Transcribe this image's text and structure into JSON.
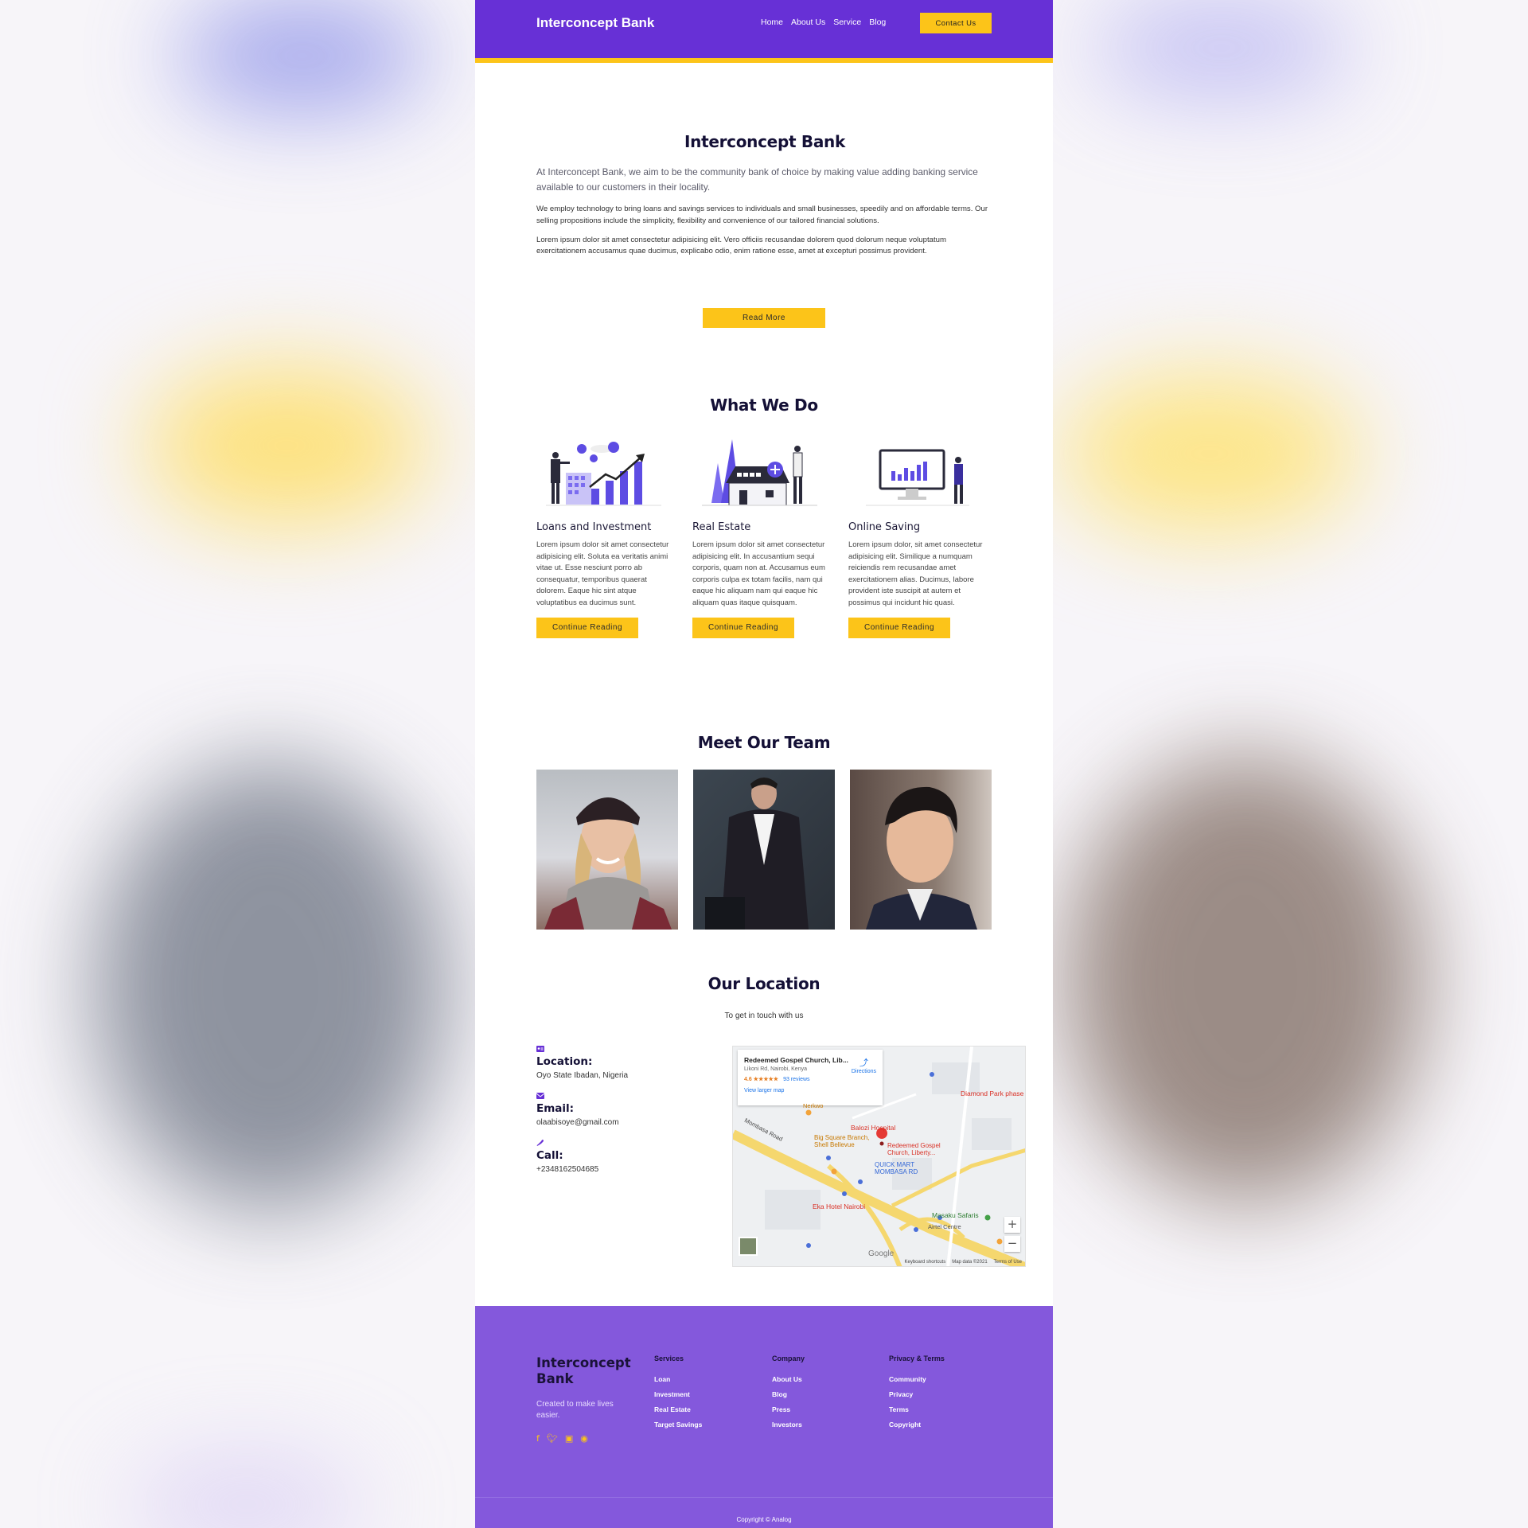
{
  "header": {
    "brand": "Interconcept Bank",
    "nav": [
      "Home",
      "About Us",
      "Service",
      "Blog"
    ],
    "contact_label": "Contact Us"
  },
  "about": {
    "title": "Interconcept Bank",
    "lead": "At Interconcept Bank, we aim to be the community bank of choice by making value adding banking service available to our customers in their locality.",
    "para1": "We employ technology to bring loans and savings services to individuals and small businesses, speedily and on affordable terms. Our selling propositions include the simplicity, flexibility and convenience of our tailored financial solutions.",
    "para2": "Lorem ipsum dolor sit amet consectetur adipisicing elit. Vero officiis recusandae dolorem quod dolorum neque voluptatum exercitationem accusamus quae ducimus, explicabo odio, enim ratione esse, amet at excepturi possimus provident.",
    "read_more": "Read More"
  },
  "what_we_do": {
    "title": "What We Do",
    "services": [
      {
        "icon": "investment-chart-illustration",
        "title": "Loans and Investment",
        "text": "Lorem ipsum dolor sit amet consectetur adipisicing elit. Soluta ea veritatis animi vitae ut. Esse nesciunt porro ab consequatur, temporibus quaerat dolorem. Eaque hic sint atque voluptatibus ea ducimus sunt.",
        "button": "Continue Reading"
      },
      {
        "icon": "house-illustration",
        "title": "Real Estate",
        "text": "Lorem ipsum dolor sit amet consectetur adipisicing elit. In accusantium sequi corporis, quam non at. Accusamus eum corporis culpa ex totam facilis, nam qui eaque hic aliquam nam qui eaque hic aliquam quas itaque quisquam.",
        "button": "Continue Reading"
      },
      {
        "icon": "monitor-chart-illustration",
        "title": "Online Saving",
        "text": "Lorem ipsum dolor, sit amet consectetur adipisicing elit. Similique a numquam reiciendis rem recusandae amet exercitationem alias. Ducimus, labore provident iste suscipit at autem et possimus qui incidunt hic quasi.",
        "button": "Continue Reading"
      }
    ]
  },
  "team": {
    "title": "Meet Our Team",
    "members": [
      "woman-in-beanie-photo",
      "man-in-suit-photo",
      "man-portrait-photo"
    ]
  },
  "location": {
    "title": "Our Location",
    "subtitle": "To get in touch with us",
    "items": [
      {
        "label": "Location:",
        "value": "Oyo State Ibadan, Nigeria",
        "icon": "id-card-icon"
      },
      {
        "label": "Email:",
        "value": "olaabisoye@gmail.com",
        "icon": "envelope-icon"
      },
      {
        "label": "Call:",
        "value": "+2348162504685",
        "icon": "phone-icon"
      }
    ],
    "map": {
      "place_name": "Redeemed Gospel Church, Lib...",
      "address": "Likoni Rd, Nairobi, Kenya",
      "rating": "4.6 ★★★★★",
      "reviews": "93 reviews",
      "directions": "Directions",
      "larger_map": "View larger map",
      "labels": [
        "Diamond Park phase",
        "Balozi Hospital",
        "Big Square Branch, Shell Bellevue",
        "Redeemed Gospel Church, Liberty...",
        "QUICK MART MOMBASA RD",
        "Eka Hotel Nairobi",
        "Masaku Safaris",
        "Airtel Centre",
        "Mombasa Road",
        "Nerkwo"
      ],
      "google": "Google",
      "footer": [
        "Keyboard shortcuts",
        "Map data ©2021",
        "Terms of Use"
      ]
    }
  },
  "footer": {
    "brand": "Interconcept Bank",
    "tagline": "Created to make lives easier.",
    "socials": [
      "facebook-icon",
      "twitter-icon",
      "instagram-icon",
      "github-icon"
    ],
    "columns": [
      {
        "title": "Services",
        "items": [
          "Loan",
          "Investment",
          "Real Estate",
          "Target Savings"
        ]
      },
      {
        "title": "Company",
        "items": [
          "About Us",
          "Blog",
          "Press",
          "Investors"
        ]
      },
      {
        "title": "Privacy & Terms",
        "items": [
          "Community",
          "Privacy",
          "Terms",
          "Copyright"
        ]
      }
    ],
    "copyright": "Copyright © Analog"
  },
  "colors": {
    "primary": "#6730d6",
    "footer": "#8458dc",
    "accent": "#fcc419"
  }
}
